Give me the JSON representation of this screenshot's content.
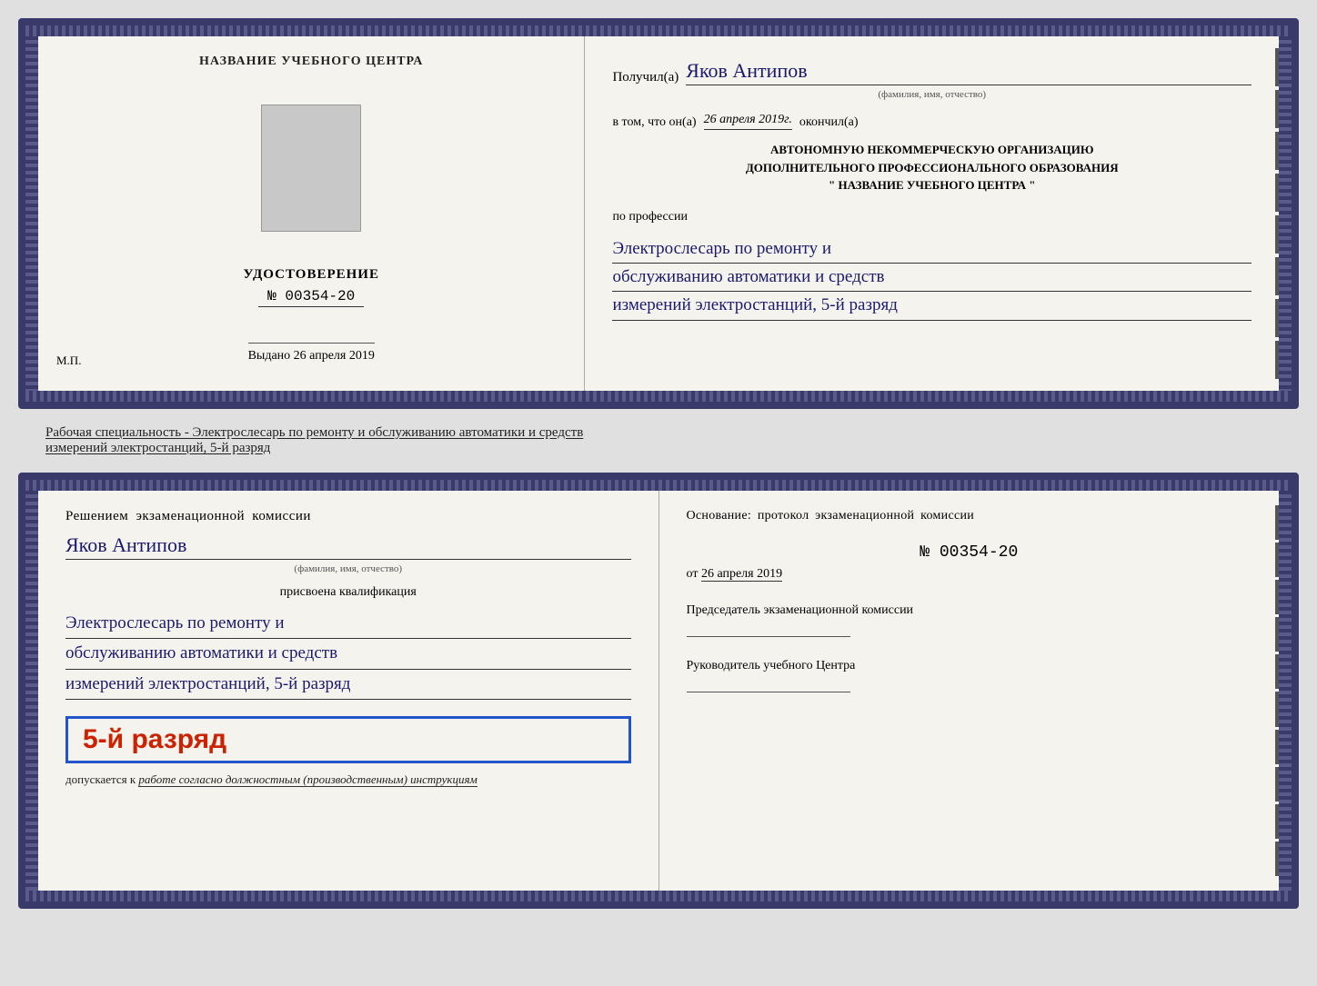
{
  "top_doc": {
    "left": {
      "center_title": "НАЗВАНИЕ УЧЕБНОГО ЦЕНТРА",
      "udostoverenie": "УДОСТОВЕРЕНИЕ",
      "num": "№ 00354-20",
      "vydano_label": "Выдано",
      "vydano_date": "26 апреля 2019",
      "mp": "М.П."
    },
    "right": {
      "poluchil_label": "Получил(а)",
      "recipient_name": "Яков Антипов",
      "fio_sub": "(фамилия, имя, отчество)",
      "vtom_label": "в том, что он(а)",
      "vtom_date": "26 апреля 2019г.",
      "okonchil": "окончил(а)",
      "org_line1": "АВТОНОМНУЮ НЕКОММЕРЧЕСКУЮ ОРГАНИЗАЦИЮ",
      "org_line2": "ДОПОЛНИТЕЛЬНОГО ПРОФЕССИОНАЛЬНОГО ОБРАЗОВАНИЯ",
      "org_name": "\" НАЗВАНИЕ УЧЕБНОГО ЦЕНТРА \"",
      "po_professii": "по профессии",
      "prof_line1": "Электрослесарь по ремонту и",
      "prof_line2": "обслуживанию автоматики и средств",
      "prof_line3": "измерений электростанций, 5-й разряд"
    }
  },
  "middle_text": {
    "line1": "Рабочая специальность - Электрослесарь по ремонту и обслуживанию автоматики и средств",
    "line2": "измерений электростанций, 5-й разряд"
  },
  "bottom_doc": {
    "left": {
      "resheniem": "Решением экзаменационной комиссии",
      "name": "Яков Антипов",
      "fio_sub": "(фамилия, имя, отчество)",
      "prisvoena": "присвоена квалификация",
      "qual_line1": "Электрослесарь по ремонту и",
      "qual_line2": "обслуживанию автоматики и средств",
      "qual_line3": "измерений электростанций, 5-й разряд",
      "razryad_badge": "5-й разряд",
      "dopuskaetsya": "допускается к",
      "dopusk_italic": "работе согласно должностным (производственным) инструкциям"
    },
    "right": {
      "osnovanie": "Основание: протокол экзаменационной комиссии",
      "prot_num": "№ 00354-20",
      "ot_label": "от",
      "ot_date": "26 апреля 2019",
      "predsedatel_label": "Председатель экзаменационной комиссии",
      "rukovoditel_label": "Руководитель учебного Центра"
    }
  }
}
